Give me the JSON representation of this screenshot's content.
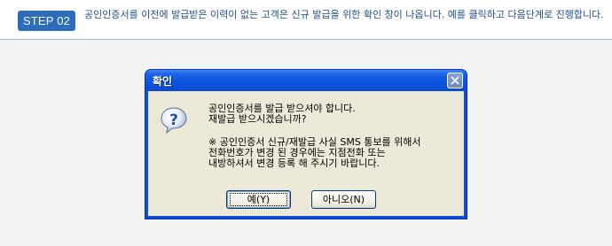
{
  "step": {
    "badge": "STEP 02",
    "description": "공인인증서를 이전에 발급받은 이력이 없는 고객은 신규 발급을 위한 확인 창이 나옵니다. 예를 클릭하고 다음단계로 진행합니다."
  },
  "dialog": {
    "title": "확인",
    "icon": "question-icon",
    "message": {
      "line1": "공인인증서를 발급 받으셔야 합니다.",
      "line2": "재발급 받으시겠습니까?",
      "note1": "※ 공인인증서 신규/재발급 사실 SMS 통보를 위해서",
      "note2": "전화번호가 변경 된 경우에는 지점전화 또는",
      "note3": "내방하셔서 변경 등록 해 주시기 바랍니다."
    },
    "buttons": {
      "yes": "예(Y)",
      "no": "아니오(N)"
    }
  },
  "colors": {
    "badge": "#2e6dbb",
    "step_text": "#1f4d8f",
    "titlebar": "#0b54df",
    "dialog_body": "#ece9d8"
  }
}
